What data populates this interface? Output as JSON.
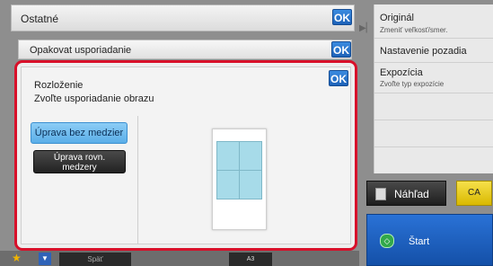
{
  "header": {
    "title": "Ostatné",
    "ok_label": "OK"
  },
  "submenu": {
    "title": "Opakovat usporiadanie",
    "ok_label": "OK"
  },
  "dialog": {
    "title": "Rozloženie",
    "subtitle": "Zvoľte usporiadanie obrazu",
    "ok_label": "OK",
    "option_selected": "Úprava bez medzier",
    "option_other_line1": "Úprava rovn.",
    "option_other_line2": "medzery"
  },
  "right_panel": {
    "items": [
      {
        "label": "Originál",
        "sub": "Zmeniť veľkosť/smer."
      },
      {
        "label": "Nastavenie pozadia",
        "sub": ""
      },
      {
        "label": "Expozícia",
        "sub": "Zvoľte typ expozície"
      }
    ]
  },
  "actions": {
    "preview": "Náhľad",
    "ca": "CA",
    "start": "Štart"
  },
  "bottom": {
    "back": "Späť",
    "paper": "A3"
  },
  "colors": {
    "accent_red": "#d8102a",
    "ok_blue": "#1d62b8",
    "start_blue": "#1450a8",
    "ca_yellow": "#d9b900"
  }
}
